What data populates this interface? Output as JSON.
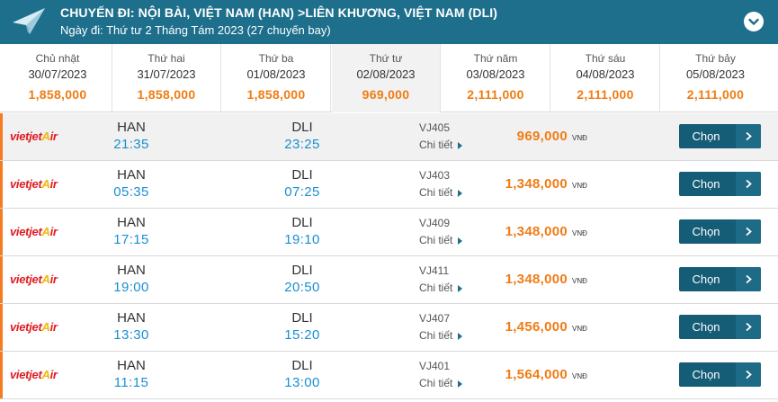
{
  "header": {
    "title": "CHUYẾN ĐI: NỘI BÀI, VIỆT NAM (HAN) >LIÊN KHƯƠNG, VIỆT NAM (DLI)",
    "subtitle": "Ngày đi: Thứ tư 2 Tháng Tám 2023 (27 chuyến bay)",
    "icons": {
      "plane": "paper-plane-icon",
      "collapse": "chevron-down-icon"
    },
    "bg_color": "#1d6f8c"
  },
  "dates": [
    {
      "dow": "Chủ nhật",
      "date": "30/07/2023",
      "price": "1,858,000"
    },
    {
      "dow": "Thứ hai",
      "date": "31/07/2023",
      "price": "1,858,000"
    },
    {
      "dow": "Thứ ba",
      "date": "01/08/2023",
      "price": "1,858,000"
    },
    {
      "dow": "Thứ tư",
      "date": "02/08/2023",
      "price": "969,000",
      "selected": true
    },
    {
      "dow": "Thứ năm",
      "date": "03/08/2023",
      "price": "2,111,000"
    },
    {
      "dow": "Thứ sáu",
      "date": "04/08/2023",
      "price": "2,111,000"
    },
    {
      "dow": "Thứ bảy",
      "date": "05/08/2023",
      "price": "2,111,000"
    }
  ],
  "flights": [
    {
      "airline": "vietjetair",
      "from": "HAN",
      "dep": "21:35",
      "to": "DLI",
      "arr": "23:25",
      "flight_no": "VJ405",
      "detail": "Chi tiết",
      "price": "969,000",
      "currency": "VNĐ",
      "button": "Chọn"
    },
    {
      "airline": "vietjetair",
      "from": "HAN",
      "dep": "05:35",
      "to": "DLI",
      "arr": "07:25",
      "flight_no": "VJ403",
      "detail": "Chi tiết",
      "price": "1,348,000",
      "currency": "VNĐ",
      "button": "Chọn"
    },
    {
      "airline": "vietjetair",
      "from": "HAN",
      "dep": "17:15",
      "to": "DLI",
      "arr": "19:10",
      "flight_no": "VJ409",
      "detail": "Chi tiết",
      "price": "1,348,000",
      "currency": "VNĐ",
      "button": "Chọn"
    },
    {
      "airline": "vietjetair",
      "from": "HAN",
      "dep": "19:00",
      "to": "DLI",
      "arr": "20:50",
      "flight_no": "VJ411",
      "detail": "Chi tiết",
      "price": "1,348,000",
      "currency": "VNĐ",
      "button": "Chọn"
    },
    {
      "airline": "vietjetair",
      "from": "HAN",
      "dep": "13:30",
      "to": "DLI",
      "arr": "15:20",
      "flight_no": "VJ407",
      "detail": "Chi tiết",
      "price": "1,456,000",
      "currency": "VNĐ",
      "button": "Chọn"
    },
    {
      "airline": "vietjetair",
      "from": "HAN",
      "dep": "11:15",
      "to": "DLI",
      "arr": "13:00",
      "flight_no": "VJ401",
      "detail": "Chi tiết",
      "price": "1,564,000",
      "currency": "VNĐ",
      "button": "Chọn"
    }
  ],
  "colors": {
    "accent": "#f07c14",
    "time": "#1a8fd0",
    "button": "#155c76"
  }
}
